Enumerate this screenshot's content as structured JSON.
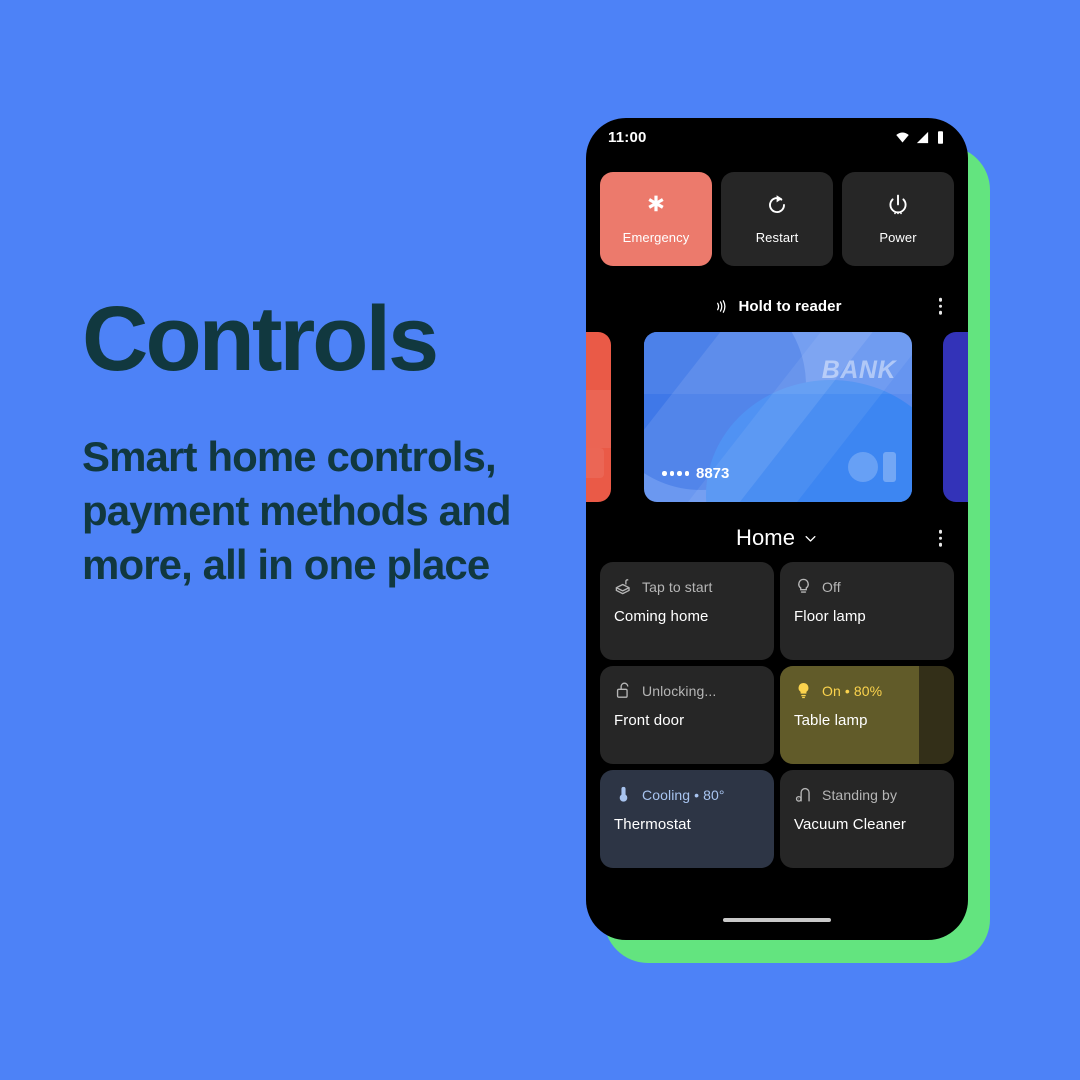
{
  "theme": {
    "background": "#4d82f7",
    "text_color": "#11383f",
    "accent_green": "#63e47f",
    "emergency_color": "#ec7a6c",
    "lamp_on_color": "#fbd34d",
    "thermostat_color": "#a8c4f0"
  },
  "marketing": {
    "headline": "Controls",
    "subheadline": "Smart home controls, payment methods and more, all in one place"
  },
  "phone": {
    "status_bar": {
      "time": "11:00",
      "icons": [
        "wifi-icon",
        "signal-icon",
        "battery-icon"
      ]
    },
    "power_menu": {
      "buttons": [
        {
          "label": "Emergency",
          "icon": "emergency-star-icon",
          "style": "emergency"
        },
        {
          "label": "Restart",
          "icon": "restart-icon",
          "style": "default"
        },
        {
          "label": "Power",
          "icon": "power-icon",
          "style": "default"
        }
      ]
    },
    "wallet": {
      "title": "Hold to reader",
      "nfc_icon": "contactless-icon",
      "overflow_icon": "more-vertical-icon",
      "card": {
        "bank_label": "BANK",
        "masked_digits": "8873",
        "dot_count": 4
      }
    },
    "home": {
      "title": "Home",
      "chevron_icon": "chevron-down-icon",
      "overflow_icon": "more-vertical-icon",
      "tiles": [
        {
          "status": "Tap to start",
          "name": "Coming home",
          "icon": "routine-device-icon",
          "state": "default",
          "fill_percent": 0
        },
        {
          "status": "Off",
          "name": "Floor lamp",
          "icon": "lamp-outline-icon",
          "state": "default",
          "fill_percent": 0
        },
        {
          "status": "Unlocking...",
          "name": "Front door",
          "icon": "lock-open-icon",
          "state": "default",
          "fill_percent": 0
        },
        {
          "status": "On • 80%",
          "name": "Table lamp",
          "icon": "lightbulb-filled-icon",
          "state": "on",
          "fill_percent": 80
        },
        {
          "status": "Cooling • 80°",
          "name": "Thermostat",
          "icon": "thermometer-icon",
          "state": "cool",
          "fill_percent": 0
        },
        {
          "status": "Standing by",
          "name": "Vacuum Cleaner",
          "icon": "vacuum-icon",
          "state": "default",
          "fill_percent": 0
        }
      ]
    }
  }
}
